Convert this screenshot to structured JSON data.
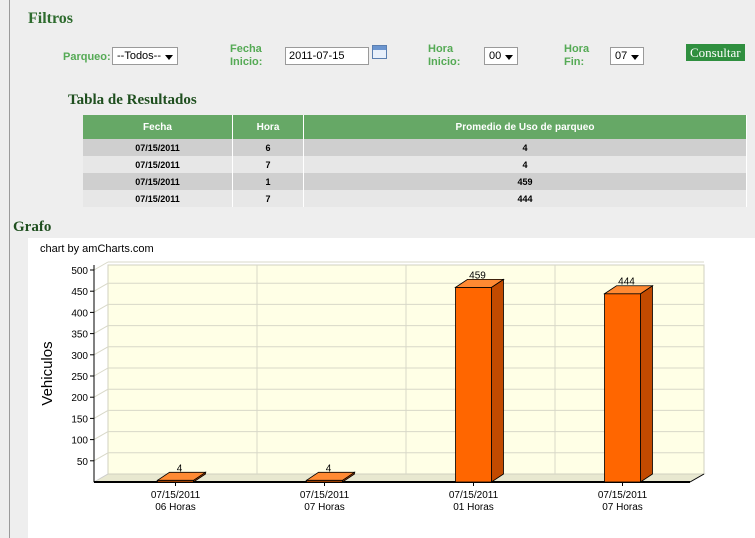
{
  "filters": {
    "title": "Filtros",
    "parqueo_label": "Parqueo:",
    "parqueo_value": "--Todos--",
    "fecha_inicio_label_1": "Fecha",
    "fecha_inicio_label_2": "Inicio:",
    "fecha_inicio_value": "2011-07-15",
    "hora_inicio_label_1": "Hora",
    "hora_inicio_label_2": "Inicio:",
    "hora_inicio_value": "00",
    "hora_fin_label_1": "Hora",
    "hora_fin_label_2": "Fin:",
    "hora_fin_value": "07",
    "consultar_label": "Consultar"
  },
  "results": {
    "title": "Tabla de Resultados",
    "columns": [
      "Fecha",
      "Hora",
      "Promedio de Uso de parqueo"
    ],
    "rows": [
      [
        "07/15/2011",
        "6",
        "4"
      ],
      [
        "07/15/2011",
        "7",
        "4"
      ],
      [
        "07/15/2011",
        "1",
        "459"
      ],
      [
        "07/15/2011",
        "7",
        "444"
      ]
    ]
  },
  "graph": {
    "title": "Grafo",
    "credit": "chart by amCharts.com"
  },
  "chart_data": {
    "type": "bar",
    "categories": [
      "07/15/2011\n06 Horas",
      "07/15/2011\n07 Horas",
      "07/15/2011\n01 Horas",
      "07/15/2011\n07 Horas"
    ],
    "values": [
      4,
      4,
      459,
      444
    ],
    "ylabel": "Vehiculos",
    "xlabel": "",
    "ylim": [
      0,
      500
    ],
    "yticks": [
      50,
      100,
      150,
      200,
      250,
      300,
      350,
      400,
      450,
      500
    ],
    "grid": true,
    "bar_color": "#ff6600",
    "plot_background": "#ffffe6"
  }
}
